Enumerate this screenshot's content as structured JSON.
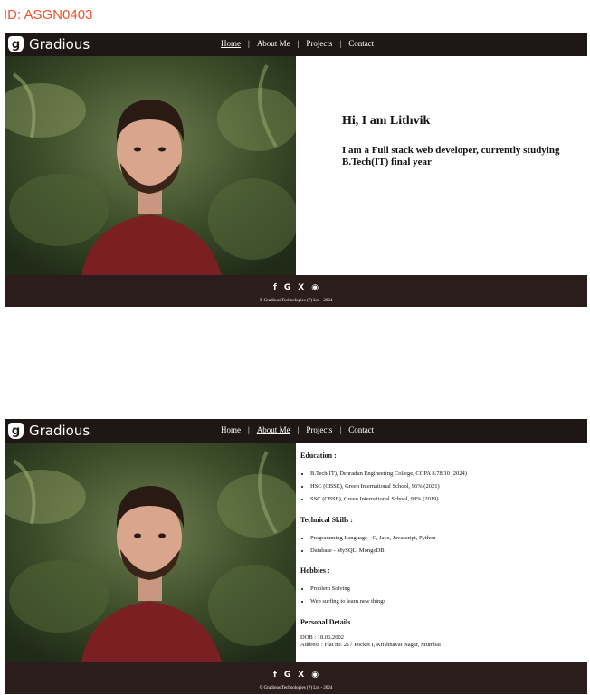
{
  "id_label": "ID: ASGN0403",
  "brand": {
    "logo_letter": "g",
    "name": "Gradious"
  },
  "nav": {
    "items": [
      "Home",
      "About Me",
      "Projects",
      "Contact"
    ],
    "separator": "|",
    "active_top": "Home",
    "active_bottom": "About Me"
  },
  "hero": {
    "greeting": "Hi, I am Lithvik",
    "intro": "I am a Full stack web developer, currently studying B.Tech(IT) final year"
  },
  "about": {
    "education_heading": "Education :",
    "education": [
      "B.Tech(IT), Dehradun Engineering College, CGPA 8.78/10 (2024)",
      "HSC (CBSE), Green International School, 96% (2021)",
      "SSC (CBSE), Green International School, 98% (2019)"
    ],
    "skills_heading": "Technical Skills :",
    "skills": [
      "Programming Language - C, Java, Javascript, Python",
      "Database - MySQL, MongoDB"
    ],
    "hobbies_heading": "Hobbies :",
    "hobbies": [
      "Problem Solving",
      "Web surfing to learn new things"
    ],
    "personal_heading": "Personal Details",
    "dob": "DOB : 18.06.2002",
    "address": "Address : Flat no. 217 Pocket I, Krishnavat Nagar, Mumbai"
  },
  "footer": {
    "icons": [
      {
        "name": "facebook-icon",
        "glyph": "f"
      },
      {
        "name": "google-icon",
        "glyph": "G"
      },
      {
        "name": "x-icon",
        "glyph": "X"
      },
      {
        "name": "github-icon",
        "glyph": "◉"
      }
    ],
    "copyright": "© Gradious Technologies (P) Ltd - 2024"
  },
  "colors": {
    "nav_bg": "#1e1716",
    "footer_bg": "#2b1d1b",
    "id_label": "#f0532b"
  }
}
